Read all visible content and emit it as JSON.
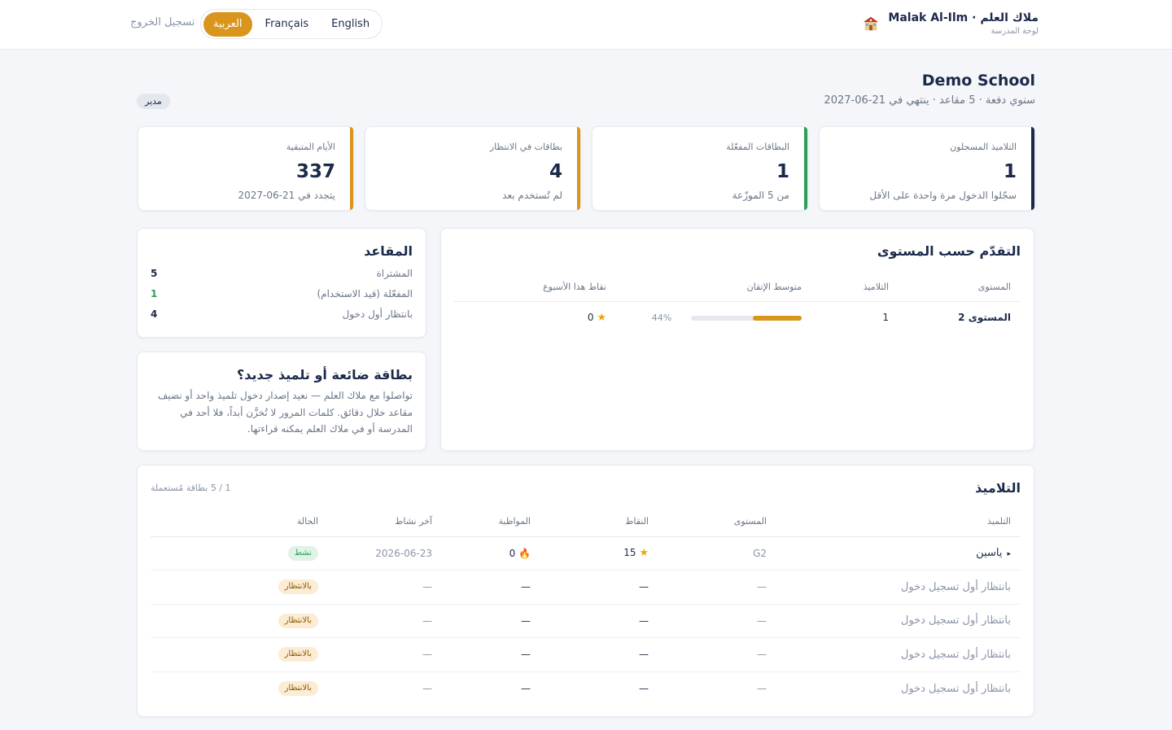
{
  "header": {
    "brand_title": "ملاك العلم · Malak Al-Ilm",
    "brand_subtitle": "لوحة المدرسة",
    "languages": [
      "العربية",
      "Français",
      "English"
    ],
    "active_language": "العربية",
    "logout_label": "تسجيل الخروج"
  },
  "school": {
    "name": "Demo School",
    "meta": "سنوي دفعة · 5 مقاعد · ينتهي في 21-06-2027",
    "role": "مدير"
  },
  "stats": [
    {
      "label": "التلاميذ المسجلون",
      "value": "1",
      "sub": "سجّلوا الدخول مرة واحدة على الأقل",
      "color": "#1b2a4a"
    },
    {
      "label": "البطاقات المفعّلة",
      "value": "1",
      "sub": "من 5 الموزّعة",
      "color": "#2e9e57"
    },
    {
      "label": "بطاقات في الانتظار",
      "value": "4",
      "sub": "لم تُستخدم بعد",
      "color": "#d9951c"
    },
    {
      "label": "الأيام المتبقية",
      "value": "337",
      "sub": "يتجدد في 21-06-2027",
      "color": "#d9951c"
    }
  ],
  "progress": {
    "title": "التقدّم حسب المستوى",
    "columns": [
      "المستوى",
      "التلاميذ",
      "متوسط الإتقان",
      "نقاط هذا الأسبوع"
    ],
    "rows": [
      {
        "level": "المستوى 2",
        "students": "1",
        "mastery": 44,
        "mastery_label": "44%",
        "points": "0"
      }
    ]
  },
  "seats": {
    "title": "المقاعد",
    "rows": [
      {
        "label": "المشتراة",
        "value": "5",
        "color": "#1b2a4a"
      },
      {
        "label": "المفعّلة (قيد الاستخدام)",
        "value": "1",
        "color": "#2e9e57"
      },
      {
        "label": "بانتظار أول دخول",
        "value": "4",
        "color": "#1b2a4a"
      }
    ]
  },
  "lost_card": {
    "title": "بطاقة ضائعة أو تلميذ جديد؟",
    "text": "تواصلوا مع ملاك العلم — نعيد إصدار دخول تلميذ واحد أو نضيف مقاعد خلال دقائق. كلمات المرور لا تُخزَّن أبداً، فلا أحد في المدرسة أو في ملاك العلم يمكنه قراءتها."
  },
  "students": {
    "title": "التلاميذ",
    "count_note": "1 / 5 بطاقة مُستعملة",
    "columns": [
      "التلميذ",
      "المستوى",
      "النقاط",
      "المواظبة",
      "آخر نشاط",
      "الحالة"
    ],
    "rows": [
      {
        "name": "ياسين",
        "level": "G2",
        "points": "15",
        "streak": "0",
        "last": "2026-06-23",
        "status": "نشط",
        "status_type": "ok"
      },
      {
        "name": "بانتظار أول تسجيل دخول",
        "level": "—",
        "points": "—",
        "streak": "—",
        "last": "—",
        "status": "بالانتظار",
        "status_type": "wait"
      },
      {
        "name": "بانتظار أول تسجيل دخول",
        "level": "—",
        "points": "—",
        "streak": "—",
        "last": "—",
        "status": "بالانتظار",
        "status_type": "wait"
      },
      {
        "name": "بانتظار أول تسجيل دخول",
        "level": "—",
        "points": "—",
        "streak": "—",
        "last": "—",
        "status": "بالانتظار",
        "status_type": "wait"
      },
      {
        "name": "بانتظار أول تسجيل دخول",
        "level": "—",
        "points": "—",
        "streak": "—",
        "last": "—",
        "status": "بالانتظار",
        "status_type": "wait"
      }
    ]
  }
}
